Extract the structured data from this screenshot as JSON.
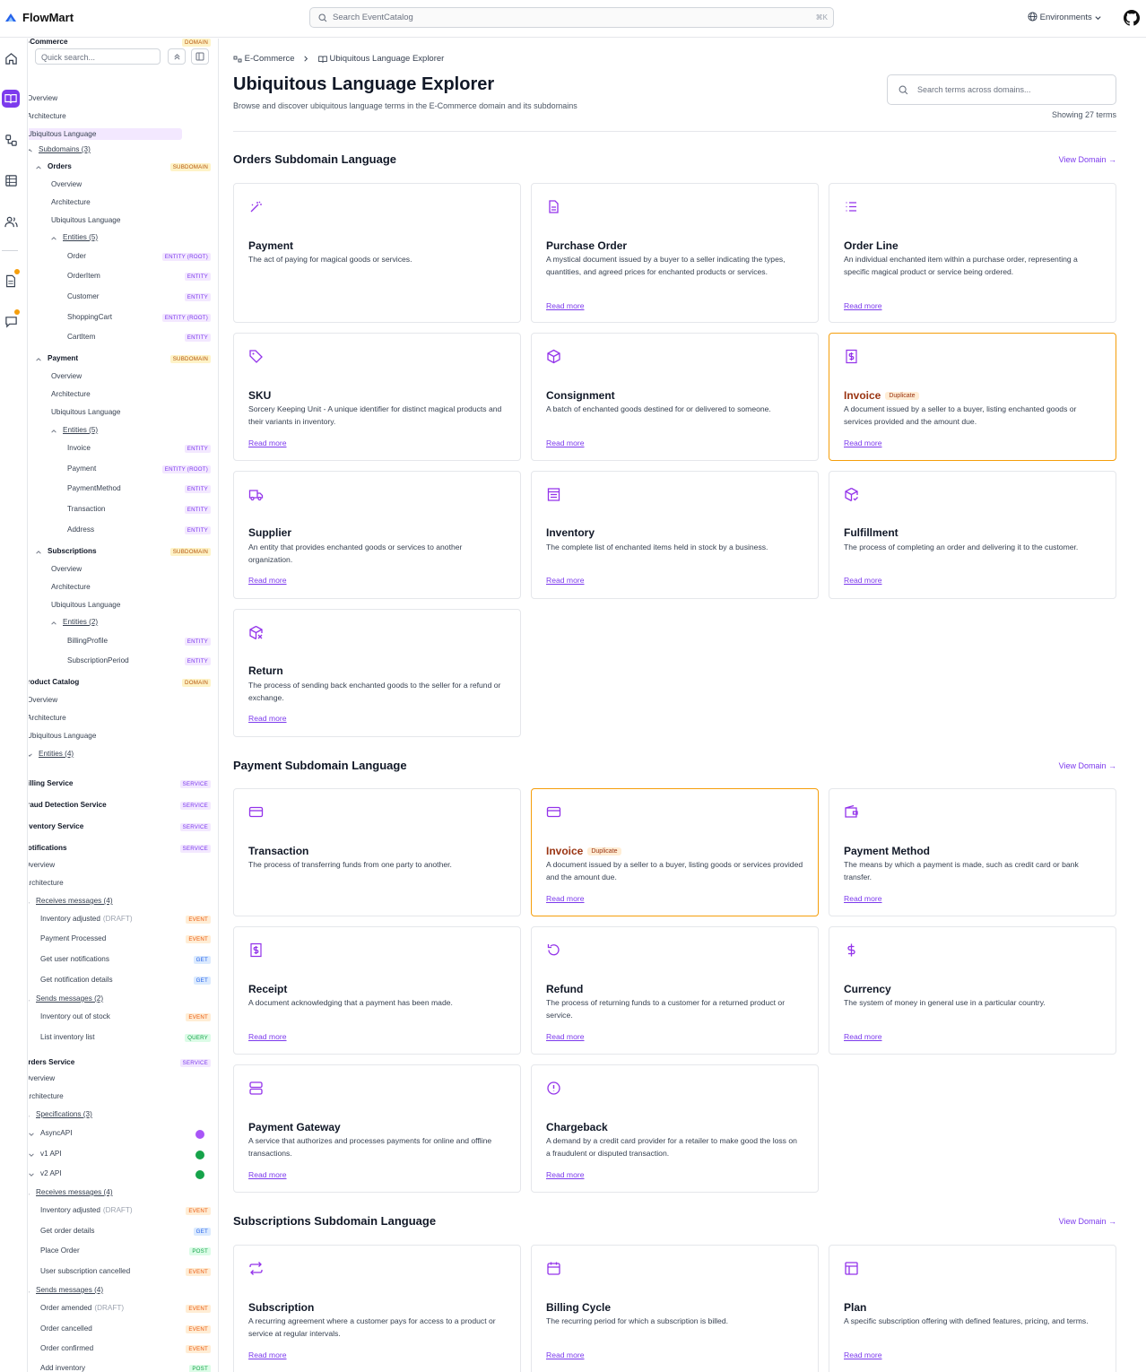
{
  "header": {
    "brand": "FlowMart",
    "search_placeholder": "Search EventCatalog",
    "search_shortcut": "⌘K",
    "env_label": "Environments",
    "logo_text": "FlowMart"
  },
  "sidebar": {
    "quick_search": "Quick search...",
    "items": [
      {
        "label": "E-Commerce",
        "tag": "DOMAIN"
      },
      {
        "label": "Overview"
      },
      {
        "label": "Architecture"
      },
      {
        "label": "Ubiquitous Language"
      },
      {
        "label": "Subdomains (3)"
      },
      {
        "label": "Orders",
        "tag": "SUBDOMAIN"
      },
      {
        "label": "Overview"
      },
      {
        "label": "Architecture"
      },
      {
        "label": "Ubiquitous Language"
      },
      {
        "label": "Entities (5)"
      },
      {
        "label": "Order",
        "tag": "ENTITY (ROOT)"
      },
      {
        "label": "OrderItem",
        "tag": "ENTITY"
      },
      {
        "label": "Customer",
        "tag": "ENTITY"
      },
      {
        "label": "ShoppingCart",
        "tag": "ENTITY (ROOT)"
      },
      {
        "label": "CartItem",
        "tag": "ENTITY"
      },
      {
        "label": "Payment",
        "tag": "SUBDOMAIN"
      },
      {
        "label": "Overview"
      },
      {
        "label": "Architecture"
      },
      {
        "label": "Ubiquitous Language"
      },
      {
        "label": "Entities (5)"
      },
      {
        "label": "Invoice",
        "tag": "ENTITY"
      },
      {
        "label": "Payment",
        "tag": "ENTITY (ROOT)"
      },
      {
        "label": "PaymentMethod",
        "tag": "ENTITY"
      },
      {
        "label": "Transaction",
        "tag": "ENTITY"
      },
      {
        "label": "Address",
        "tag": "ENTITY"
      },
      {
        "label": "Subscriptions",
        "tag": "SUBDOMAIN"
      },
      {
        "label": "Overview"
      },
      {
        "label": "Architecture"
      },
      {
        "label": "Ubiquitous Language"
      },
      {
        "label": "Entities (2)"
      },
      {
        "label": "BillingProfile",
        "tag": "ENTITY"
      },
      {
        "label": "SubscriptionPeriod",
        "tag": "ENTITY"
      },
      {
        "label": "Product Catalog",
        "tag": "DOMAIN"
      },
      {
        "label": "Overview"
      },
      {
        "label": "Architecture"
      },
      {
        "label": "Ubiquitous Language"
      },
      {
        "label": "Entities (4)"
      },
      {
        "label": "Billing Service",
        "tag": "SERVICE"
      },
      {
        "label": "Fraud Detection Service",
        "tag": "SERVICE"
      },
      {
        "label": "Inventory Service",
        "tag": "SERVICE"
      },
      {
        "label": "Notifications",
        "tag": "SERVICE"
      },
      {
        "label": "Overview"
      },
      {
        "label": "Architecture"
      },
      {
        "label": "Receives messages (4)"
      },
      {
        "label": "Inventory adjusted",
        "draft": "(DRAFT)",
        "tag": "EVENT"
      },
      {
        "label": "Payment Processed",
        "tag": "EVENT"
      },
      {
        "label": "Get user notifications",
        "tag": "GET"
      },
      {
        "label": "Get notification details",
        "tag": "GET"
      },
      {
        "label": "Sends messages (2)"
      },
      {
        "label": "Inventory out of stock",
        "tag": "EVENT"
      },
      {
        "label": "List inventory list",
        "tag": "QUERY"
      },
      {
        "label": "Orders Service",
        "tag": "SERVICE"
      },
      {
        "label": "Overview"
      },
      {
        "label": "Architecture"
      },
      {
        "label": "Specifications (3)"
      },
      {
        "label": "AsyncAPI"
      },
      {
        "label": "v1 API"
      },
      {
        "label": "v2 API"
      },
      {
        "label": "Receives messages (4)"
      },
      {
        "label": "Inventory adjusted",
        "draft": "(DRAFT)",
        "tag": "EVENT"
      },
      {
        "label": "Get order details",
        "tag": "GET"
      },
      {
        "label": "Place Order",
        "tag": "POST"
      },
      {
        "label": "User subscription cancelled",
        "tag": "EVENT"
      },
      {
        "label": "Sends messages (4)"
      },
      {
        "label": "Order amended",
        "draft": "(DRAFT)",
        "tag": "EVENT"
      },
      {
        "label": "Order cancelled",
        "tag": "EVENT"
      },
      {
        "label": "Order confirmed",
        "tag": "EVENT"
      },
      {
        "label": "Add inventory",
        "tag": "POST"
      }
    ]
  },
  "breadcrumb": {
    "parent": "E-Commerce",
    "current": "Ubiquitous Language Explorer"
  },
  "page": {
    "title": "Ubiquitous Language Explorer",
    "subtitle": "Browse and discover ubiquitous language terms in the E-Commerce domain and its subdomains",
    "search_placeholder": "Search terms across domains...",
    "count": "Showing 27 terms",
    "view_domain": "View Domain →",
    "read_more": "Read more",
    "duplicate": "Duplicate"
  },
  "sections": [
    {
      "title": "Orders Subdomain Language",
      "cards": [
        {
          "title": "Payment",
          "desc": "The act of paying for magical goods or services.",
          "icon": "magic-wand-icon",
          "read_more": false
        },
        {
          "title": "Purchase Order",
          "desc": "A mystical document issued by a buyer to a seller indicating the types, quantities, and agreed prices for enchanted products or services.",
          "icon": "document-icon",
          "read_more": true
        },
        {
          "title": "Order Line",
          "desc": "An individual enchanted item within a purchase order, representing a specific magical product or service being ordered.",
          "icon": "list-icon",
          "read_more": true
        },
        {
          "title": "SKU",
          "desc": "Sorcery Keeping Unit - A unique identifier for distinct magical products and their variants in inventory.",
          "icon": "tag-icon",
          "read_more": true
        },
        {
          "title": "Consignment",
          "desc": "A batch of enchanted goods destined for or delivered to someone.",
          "icon": "package-icon",
          "read_more": true
        },
        {
          "title": "Invoice",
          "desc": "A document issued by a seller to a buyer, listing enchanted goods or services provided and the amount due.",
          "icon": "receipt-icon",
          "read_more": true,
          "duplicate": true
        },
        {
          "title": "Supplier",
          "desc": "An entity that provides enchanted goods or services to another organization.",
          "icon": "truck-icon",
          "read_more": true
        },
        {
          "title": "Inventory",
          "desc": "The complete list of enchanted items held in stock by a business.",
          "icon": "archive-icon",
          "read_more": true
        },
        {
          "title": "Fulfillment",
          "desc": "The process of completing an order and delivering it to the customer.",
          "icon": "package-check-icon",
          "read_more": true
        },
        {
          "title": "Return",
          "desc": "The process of sending back enchanted goods to the seller for a refund or exchange.",
          "icon": "package-x-icon",
          "read_more": true
        }
      ]
    },
    {
      "title": "Payment Subdomain Language",
      "cards": [
        {
          "title": "Transaction",
          "desc": "The process of transferring funds from one party to another.",
          "icon": "credit-card-icon",
          "read_more": false
        },
        {
          "title": "Invoice",
          "desc": "A document issued by a seller to a buyer, listing goods or services provided and the amount due.",
          "icon": "credit-card-icon",
          "read_more": true,
          "duplicate": true
        },
        {
          "title": "Payment Method",
          "desc": "The means by which a payment is made, such as credit card or bank transfer.",
          "icon": "wallet-icon",
          "read_more": true
        },
        {
          "title": "Receipt",
          "desc": "A document acknowledging that a payment has been made.",
          "icon": "receipt-icon",
          "read_more": true
        },
        {
          "title": "Refund",
          "desc": "The process of returning funds to a customer for a returned product or service.",
          "icon": "rotate-icon",
          "read_more": true
        },
        {
          "title": "Currency",
          "desc": "The system of money in general use in a particular country.",
          "icon": "dollar-icon",
          "read_more": true
        },
        {
          "title": "Payment Gateway",
          "desc": "A service that authorizes and processes payments for online and offline transactions.",
          "icon": "server-icon",
          "read_more": true
        },
        {
          "title": "Chargeback",
          "desc": "A demand by a credit card provider for a retailer to make good the loss on a fraudulent or disputed transaction.",
          "icon": "alert-icon",
          "read_more": true
        }
      ]
    },
    {
      "title": "Subscriptions Subdomain Language",
      "cards": [
        {
          "title": "Subscription",
          "desc": "A recurring agreement where a customer pays for access to a product or service at regular intervals.",
          "icon": "repeat-icon",
          "read_more": true
        },
        {
          "title": "Billing Cycle",
          "desc": "The recurring period for which a subscription is billed.",
          "icon": "calendar-icon",
          "read_more": true
        },
        {
          "title": "Plan",
          "desc": "A specific subscription offering with defined features, pricing, and terms.",
          "icon": "layout-icon",
          "read_more": true
        }
      ]
    }
  ],
  "colors": {
    "accent": "#7c3aed",
    "duplicate": "#f59e0b"
  }
}
